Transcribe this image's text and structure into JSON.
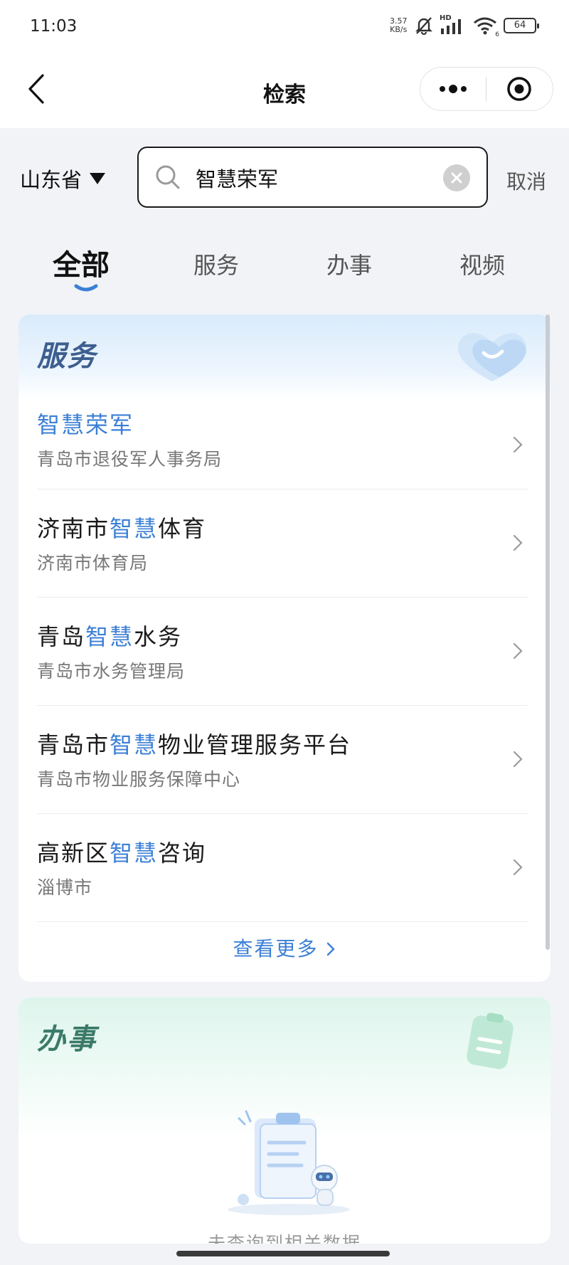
{
  "status_bar": {
    "time": "11:03",
    "speed_value": "3.57",
    "speed_unit": "KB/s",
    "network": "HD",
    "wifi_badge": "6",
    "battery": "64"
  },
  "nav": {
    "title": "检索"
  },
  "search": {
    "region": "山东省",
    "query": "智慧荣军",
    "cancel_label": "取消"
  },
  "tabs": [
    {
      "label": "全部"
    },
    {
      "label": "服务"
    },
    {
      "label": "办事"
    },
    {
      "label": "视频"
    }
  ],
  "services": {
    "heading": "服务",
    "results": [
      {
        "title_pre": "",
        "title_hl": "智慧荣军",
        "title_post": "",
        "subtitle": "青岛市退役军人事务局"
      },
      {
        "title_pre": "济南市",
        "title_hl": "智慧",
        "title_post": "体育",
        "subtitle": "济南市体育局"
      },
      {
        "title_pre": "青岛",
        "title_hl": "智慧",
        "title_post": "水务",
        "subtitle": "青岛市水务管理局"
      },
      {
        "title_pre": "青岛市",
        "title_hl": "智慧",
        "title_post": "物业管理服务平台",
        "subtitle": "青岛市物业服务保障中心"
      },
      {
        "title_pre": "高新区",
        "title_hl": "智慧",
        "title_post": "咨询",
        "subtitle": "淄博市"
      }
    ],
    "more_label": "查看更多"
  },
  "affairs": {
    "heading": "办事",
    "empty_text": "未查询到相关数据"
  },
  "colors": {
    "highlight": "#3b7fd6",
    "page_bg": "#f1f3f6"
  },
  "icons": {
    "back": "chevron-left-icon",
    "more": "more-dots-icon",
    "close_mini": "target-circle-icon",
    "search": "search-icon",
    "clear": "clear-icon",
    "dropdown": "triangle-down-icon",
    "row": "chevron-right-icon"
  }
}
